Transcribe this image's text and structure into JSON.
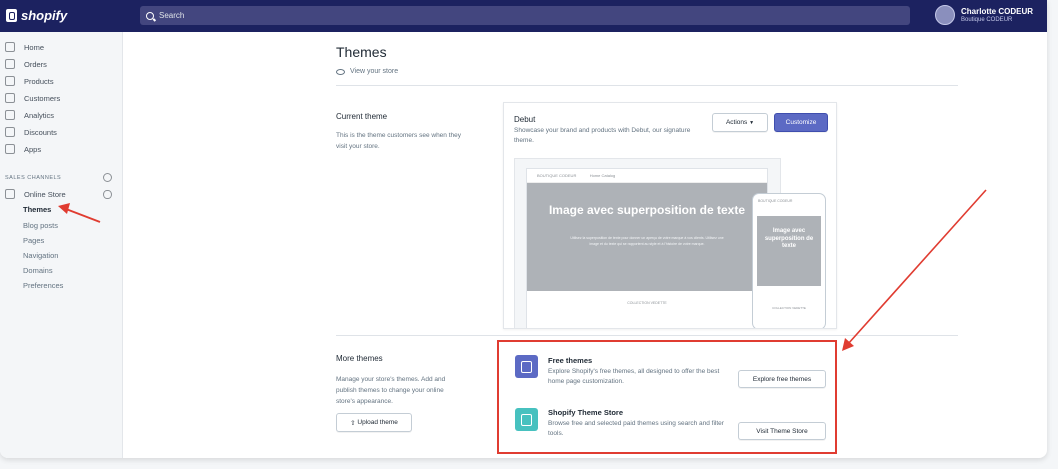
{
  "topbar": {
    "logo_text": "shopify",
    "search_placeholder": "Search",
    "user_name": "Charlotte CODEUR",
    "user_store": "Boutique CODEUR"
  },
  "sidebar": {
    "items": [
      {
        "label": "Home",
        "icon": "home-icon"
      },
      {
        "label": "Orders",
        "icon": "orders-icon"
      },
      {
        "label": "Products",
        "icon": "tag-icon"
      },
      {
        "label": "Customers",
        "icon": "person-icon"
      },
      {
        "label": "Analytics",
        "icon": "bar-chart-icon"
      },
      {
        "label": "Discounts",
        "icon": "discount-icon"
      },
      {
        "label": "Apps",
        "icon": "apps-icon"
      }
    ],
    "section_label": "SALES CHANNELS",
    "channel": {
      "label": "Online Store",
      "icon": "store-icon"
    },
    "sub_items": [
      "Themes",
      "Blog posts",
      "Pages",
      "Navigation",
      "Domains",
      "Preferences"
    ]
  },
  "main": {
    "title": "Themes",
    "view_store": "View your store",
    "current_theme": {
      "heading": "Current theme",
      "description": "This is the theme customers see when they visit your store.",
      "theme_name": "Debut",
      "theme_description": "Showcase your brand and products with Debut, our signature theme.",
      "actions_label": "Actions",
      "customize_label": "Customize",
      "preview": {
        "store_name": "BOUTIQUE CODEUR",
        "nav_items": "Home   Catalog",
        "hero_title": "Image avec superposition de texte",
        "hero_text": "Utilisez la superposition de texte pour donner un aperçu de votre marque à vos clients. Utilisez une image et du texte qui se rapportent au style et à l'histoire de votre marque.",
        "collection_label": "COLLECTION VEDETTE",
        "mobile_store_name": "BOUTIQUE CODEUR",
        "mobile_hero_title": "Image avec superposition de texte",
        "mobile_collection_label": "COLLECTION VEDETTE"
      }
    },
    "more_themes": {
      "heading": "More themes",
      "description": "Manage your store's themes. Add and publish themes to change your online store's appearance.",
      "upload_label": "Upload theme",
      "free_themes": {
        "title": "Free themes",
        "description": "Explore Shopify's free themes, all designed to offer the best home page customization.",
        "button": "Explore free themes",
        "icon_color": "#5c6ac4"
      },
      "theme_store": {
        "title": "Shopify Theme Store",
        "description": "Browse free and selected paid themes using search and filter tools.",
        "button": "Visit Theme Store",
        "icon_color": "#47c1bf"
      }
    }
  },
  "colors": {
    "topbar": "#1c2260",
    "primary": "#5c6ac4",
    "annotation": "#e03c31"
  }
}
